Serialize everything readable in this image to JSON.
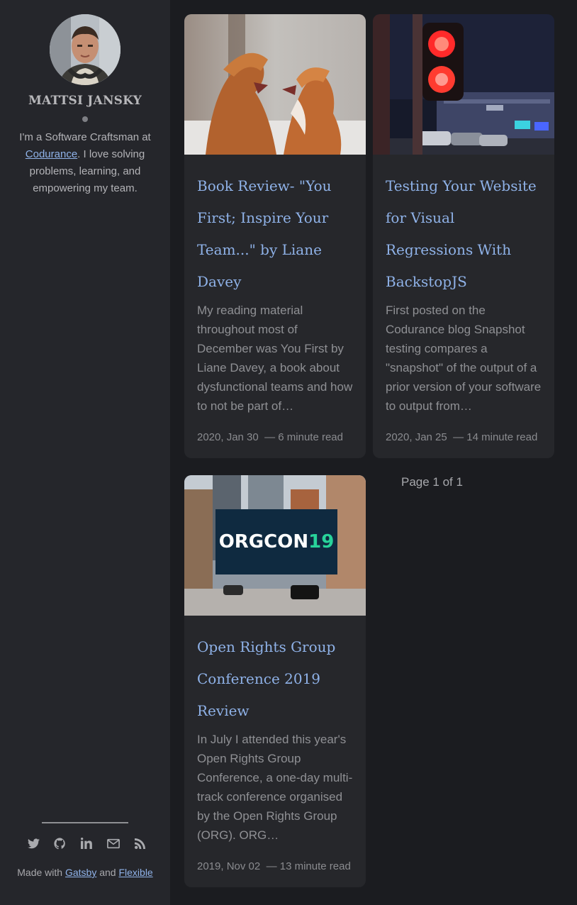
{
  "sidebar": {
    "author_name": "MATTSI JANSKY",
    "bio_prefix": "I'm a Software Craftsman at ",
    "bio_link": "Codurance",
    "bio_suffix": ". I love solving problems, learning, and empowering my team.",
    "social_icons": [
      "twitter-icon",
      "github-icon",
      "linkedin-icon",
      "email-icon",
      "rss-icon"
    ],
    "made_with_prefix": "Made with ",
    "made_with_link1": "Gatsby",
    "made_with_and": " and ",
    "made_with_link2": "Flexible"
  },
  "posts": [
    {
      "title": "Book Review- \"You First; Inspire Your Team...\" by Liane Davey",
      "excerpt": "My reading material throughout most of December was You First by Liane Davey, a book about dysfunctional teams and how to not be part of…",
      "date": "2020, Jan 30",
      "reading_time": "6 minute read"
    },
    {
      "title": "Testing Your Website for Visual Regressions With BackstopJS",
      "excerpt": "First posted on the Codurance blog Snapshot testing compares a \"snapshot\" of the output of a prior version of your software to output from…",
      "date": "2020, Jan 25",
      "reading_time": "14 minute read"
    },
    {
      "title": "Open Rights Group Conference 2019 Review",
      "excerpt": "In July I attended this year's Open Rights Group Conference, a one-day multi-track conference organised by the Open Rights Group (ORG). ORG…",
      "date": "2019, Nov 02",
      "reading_time": "13 minute read",
      "image_text": "ORGCON19"
    }
  ],
  "pagination": {
    "label": "Page 1 of 1"
  },
  "colors": {
    "background": "#1b1c20",
    "sidebar": "#25262b",
    "card": "#26272b",
    "link": "#8fb2e8"
  }
}
